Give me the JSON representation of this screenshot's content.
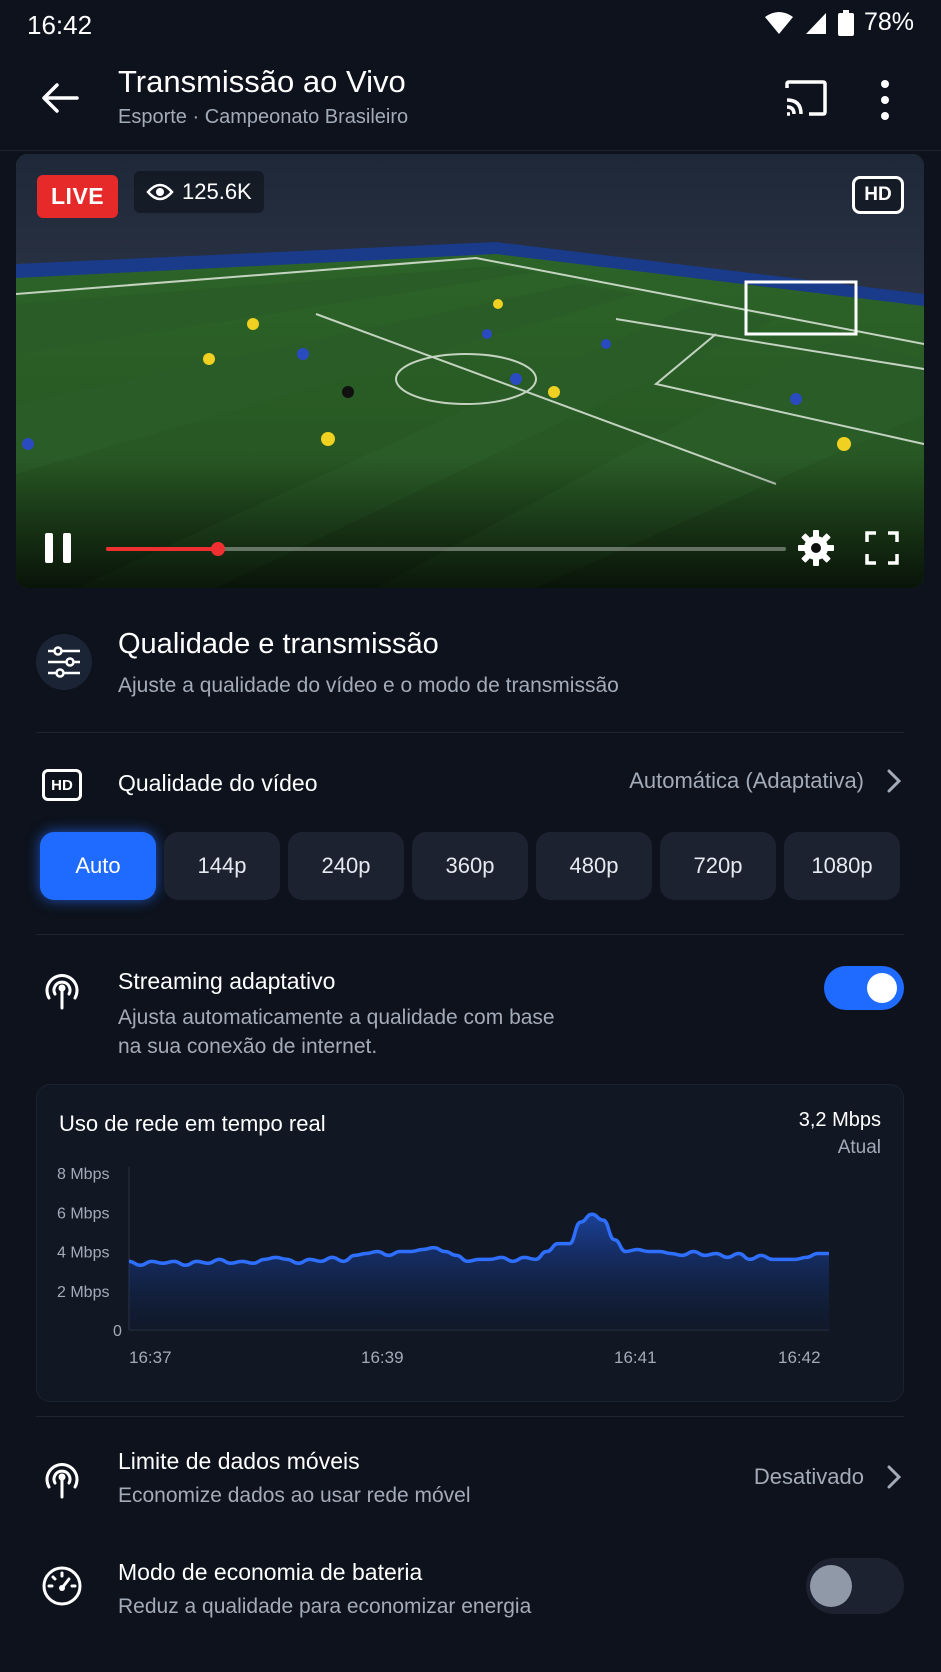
{
  "status": {
    "time": "16:42",
    "battery": "78%"
  },
  "appbar": {
    "title": "Transmissão ao Vivo",
    "subtitle": "Esporte · Campeonato Brasileiro"
  },
  "video": {
    "live_label": "LIVE",
    "viewers": "125.6K",
    "hd_label": "HD",
    "progress": 0.165
  },
  "section": {
    "title": "Qualidade e transmissão",
    "subtitle": "Ajuste a qualidade do vídeo e o modo de transmissão"
  },
  "quality": {
    "icon_label": "HD",
    "title": "Qualidade do vídeo",
    "value": "Automática (Adaptativa)",
    "options": [
      "Auto",
      "144p",
      "240p",
      "360p",
      "480p",
      "720p",
      "1080p"
    ],
    "selected": "Auto"
  },
  "adaptive": {
    "title": "Streaming adaptativo",
    "description_line1": "Ajusta automaticamente a qualidade com base",
    "description_line2": "na sua conexão de internet.",
    "enabled": true
  },
  "network_chart": {
    "title": "Uso de rede em tempo real",
    "current_value": "3,2 Mbps",
    "current_label": "Atual"
  },
  "chart_data": {
    "type": "area",
    "title": "Uso de rede em tempo real",
    "xlabel": "",
    "ylabel": "",
    "y_ticks": [
      "0",
      "2 Mbps",
      "4 Mbps",
      "6 Mbps",
      "8 Mbps"
    ],
    "x_ticks": [
      "16:37",
      "16:39",
      "16:41",
      "16:42"
    ],
    "ylim": [
      0,
      8
    ],
    "series": [
      {
        "values": [
          3.5,
          3.3,
          3.5,
          3.4,
          3.5,
          3.3,
          3.5,
          3.4,
          3.6,
          3.4,
          3.5,
          3.4,
          3.6,
          3.7,
          3.6,
          3.4,
          3.6,
          3.5,
          3.7,
          3.5,
          3.8,
          3.9,
          4.0,
          3.8,
          4.0,
          4.0,
          4.1,
          4.2,
          4.0,
          3.8,
          3.5,
          3.6,
          3.6,
          3.7,
          3.5,
          3.7,
          3.6,
          4.0,
          4.4,
          4.4,
          5.5,
          5.9,
          5.6,
          4.6,
          4.0,
          4.1,
          4.0,
          4.0,
          3.9,
          3.8,
          4.0,
          3.8,
          3.9,
          3.7,
          3.9,
          3.6,
          3.8,
          3.6,
          3.6,
          3.6,
          3.7,
          3.9,
          3.9
        ]
      }
    ]
  },
  "mobile_data": {
    "title": "Limite de dados móveis",
    "description": "Economize dados ao usar rede móvel",
    "value": "Desativado"
  },
  "battery_saver": {
    "title": "Modo de economia de bateria",
    "description": "Reduz a qualidade para economizar energia",
    "enabled": false
  },
  "colors": {
    "accent": "#1f6bff",
    "live": "#e62a2a",
    "background": "#0d121c"
  }
}
